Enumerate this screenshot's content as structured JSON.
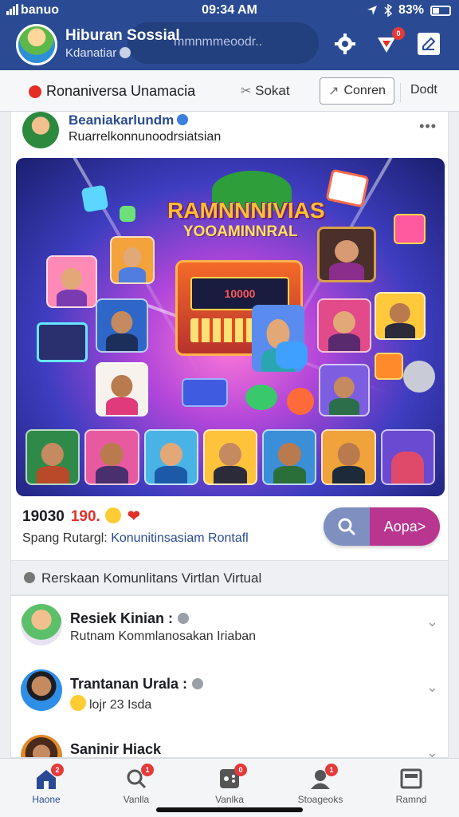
{
  "status": {
    "carrier": "banuo",
    "time": "09:34 AM",
    "battery": "83%"
  },
  "header": {
    "title": "Hiburan Sossial",
    "subtitle": "Kdanatiar",
    "search_placeholder": "mmnmmeoodr..",
    "notif_count": "0"
  },
  "tabs": {
    "channel": "Ronaniversa Unamacia",
    "link": "Sokat",
    "button": "Conren",
    "more": "Dodt"
  },
  "post": {
    "author": "Beaniakarlundm",
    "description": "Ruarrelkonnunoodrsiatsian",
    "hero_title": "RAMNNNIVIAS",
    "hero_subtitle": "YOOAMINNRAL",
    "machine_display": "10000",
    "stat_count": "19030",
    "stat_secondary": "190.",
    "tagline_prefix": "Spang Rutargl:",
    "tagline_link": "Konunitinsasiam Rontafl",
    "cta_label": "Aopa>"
  },
  "section": {
    "title": "Rerskaan Komunlitans Virtlan Virtual"
  },
  "list": [
    {
      "name": "Resiek Kinian :",
      "desc": "Rutnam Kommlanosakan Iriaban"
    },
    {
      "name": "Trantanan Urala :",
      "desc": "lojr 23 Isda"
    },
    {
      "name": "Saninir Hiack",
      "desc": ""
    }
  ],
  "nav": [
    {
      "label": "Haone",
      "badge": "2",
      "icon": "home-icon"
    },
    {
      "label": "Vanlla",
      "badge": "1",
      "icon": "search-icon"
    },
    {
      "label": "Vanlka",
      "badge": "0",
      "icon": "game-icon"
    },
    {
      "label": "Stoageoks",
      "badge": "1",
      "icon": "friends-icon"
    },
    {
      "label": "Ramnd",
      "badge": "",
      "icon": "menu-icon"
    }
  ],
  "colors": {
    "brand": "#2a4b93",
    "accent": "#b8368f",
    "danger": "#e0312a"
  }
}
